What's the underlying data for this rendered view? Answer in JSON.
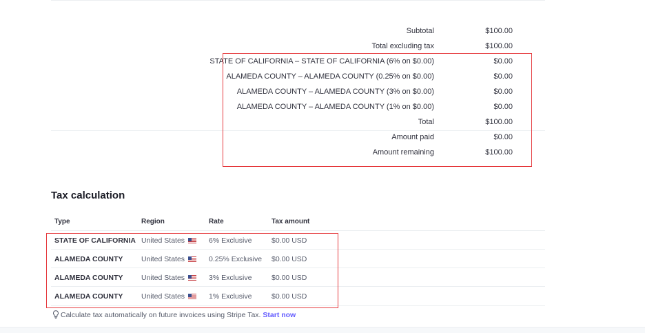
{
  "summary": {
    "rows": [
      {
        "label": "Subtotal",
        "value": "$100.00"
      },
      {
        "label": "Total excluding tax",
        "value": "$100.00"
      },
      {
        "label": "STATE OF CALIFORNIA – STATE OF CALIFORNIA (6% on $0.00)",
        "value": "$0.00"
      },
      {
        "label": "ALAMEDA COUNTY – ALAMEDA COUNTY (0.25% on $0.00)",
        "value": "$0.00"
      },
      {
        "label": "ALAMEDA COUNTY – ALAMEDA COUNTY (3% on $0.00)",
        "value": "$0.00"
      },
      {
        "label": "ALAMEDA COUNTY – ALAMEDA COUNTY (1% on $0.00)",
        "value": "$0.00"
      },
      {
        "label": "Total",
        "value": "$100.00"
      },
      {
        "label": "Amount paid",
        "value": "$0.00"
      },
      {
        "label": "Amount remaining",
        "value": "$100.00"
      }
    ]
  },
  "tax_calculation": {
    "title": "Tax calculation",
    "headers": {
      "type": "Type",
      "region": "Region",
      "rate": "Rate",
      "amount": "Tax amount"
    },
    "rows": [
      {
        "type": "STATE OF CALIFORNIA",
        "region": "United States",
        "rate": "6% Exclusive",
        "amount": "$0.00 USD"
      },
      {
        "type": "ALAMEDA COUNTY",
        "region": "United States",
        "rate": "0.25% Exclusive",
        "amount": "$0.00 USD"
      },
      {
        "type": "ALAMEDA COUNTY",
        "region": "United States",
        "rate": "3% Exclusive",
        "amount": "$0.00 USD"
      },
      {
        "type": "ALAMEDA COUNTY",
        "region": "United States",
        "rate": "1% Exclusive",
        "amount": "$0.00 USD"
      }
    ],
    "region_flag_icon": "us-flag-icon"
  },
  "note": {
    "text": "Calculate tax automatically on future invoices using Stripe Tax.",
    "link": "Start now",
    "icon": "lightbulb-icon"
  },
  "colors": {
    "highlight_border": "#e5393d",
    "link": "#635bff"
  }
}
